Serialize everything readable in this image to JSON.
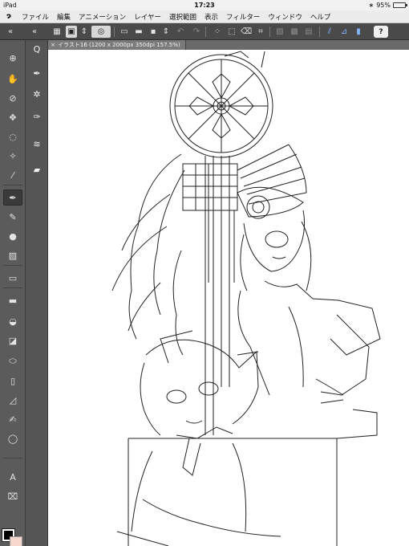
{
  "status": {
    "carrier": "iPad",
    "time": "17:23",
    "bluetooth": "∗",
    "battery_pct": "95%",
    "battery_fraction": 0.95
  },
  "menu": {
    "items": [
      "ファイル",
      "編集",
      "アニメーション",
      "レイヤー",
      "選択範囲",
      "表示",
      "フィルター",
      "ウィンドウ",
      "ヘルプ"
    ]
  },
  "toolbar": {
    "help_label": "?"
  },
  "canvas": {
    "tab_title": "イラスト16 (1200 x 2000px 350dpi 157.5%)",
    "tab_close": "×"
  },
  "left_tools": {
    "text_tool": "A"
  },
  "colors": {
    "main": "#000000",
    "sub": "#f7d8cf",
    "accent": "#4cd964"
  }
}
